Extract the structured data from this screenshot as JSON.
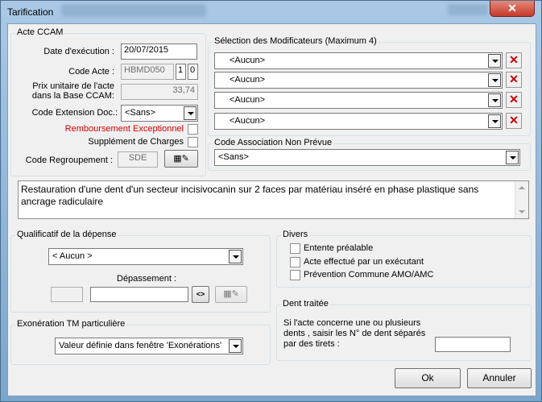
{
  "window": {
    "title": "Tarification"
  },
  "acte": {
    "group_label": "Acte CCAM",
    "date_label": "Date d'exécution :",
    "date_value": "20/07/2015",
    "code_label": "Code Acte :",
    "code_value": "HBMD050",
    "code_part2": "1",
    "code_part3": "0",
    "prix_label_1": "Prix unitaire de l'acte",
    "prix_label_2": "dans la Base CCAM:",
    "prix_value": "33,74",
    "ext_label": "Code Extension Doc.:",
    "ext_value": "<Sans>",
    "remb_label": "Remboursement Exceptionnel",
    "supp_label": "Supplément de Charges",
    "regroup_label": "Code Regroupement :",
    "regroup_value": "SDE"
  },
  "modificateurs": {
    "group_label": "Sélection des Modificateurs (Maximum 4)",
    "items": [
      "<Aucun>",
      "<Aucun>",
      "<Aucun>",
      "<Aucun>"
    ]
  },
  "association": {
    "group_label": "Code Association Non Prévue",
    "value": "<Sans>"
  },
  "description": "Restauration d'une dent d'un secteur incisivocanin sur 2 faces par matériau inséré en phase plastique sans ancrage radiculaire",
  "qualificatif": {
    "group_label": "Qualificatif de la dépense",
    "value": "< Aucun >",
    "depassement_label": "Dépassement :"
  },
  "divers": {
    "group_label": "Divers",
    "items": [
      "Entente préalable",
      "Acte effectué par un exécutant",
      "Prévention Commune AMO/AMC"
    ]
  },
  "exoneration": {
    "group_label": "Exonération TM particulière",
    "value": "Valeur définie dans fenêtre 'Exonérations'"
  },
  "dent": {
    "group_label": "Dent traitée",
    "text_1": "Si l'acte concerne une ou plusieurs",
    "text_2": "dents , saisir les N° de dent séparés",
    "text_3": "par des tirets :"
  },
  "buttons": {
    "ok": "Ok",
    "cancel": "Annuler"
  }
}
